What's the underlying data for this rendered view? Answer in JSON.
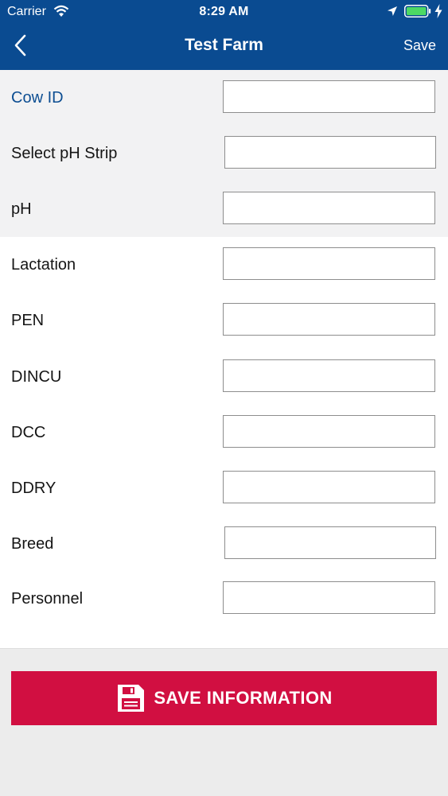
{
  "status_bar": {
    "carrier": "Carrier",
    "time": "8:29 AM"
  },
  "nav": {
    "title": "Test Farm",
    "save_label": "Save"
  },
  "form": {
    "fields": [
      {
        "label": "Cow ID",
        "value": ""
      },
      {
        "label": "Select pH Strip",
        "value": ""
      },
      {
        "label": "pH",
        "value": ""
      },
      {
        "label": "Lactation",
        "value": ""
      },
      {
        "label": "PEN",
        "value": ""
      },
      {
        "label": "DINCU",
        "value": ""
      },
      {
        "label": "DCC",
        "value": ""
      },
      {
        "label": "DDRY",
        "value": ""
      },
      {
        "label": "Breed",
        "value": ""
      },
      {
        "label": "Personnel",
        "value": ""
      }
    ]
  },
  "footer": {
    "save_button_label": "SAVE INFORMATION"
  },
  "colors": {
    "nav_background": "#0a4b91",
    "accent_label": "#0d4e92",
    "save_button": "#d10f41"
  },
  "icons": {
    "back": "chevron-left-icon",
    "wifi": "wifi-icon",
    "location": "location-arrow-icon",
    "battery": "battery-icon",
    "charging": "charging-bolt-icon",
    "save": "floppy-disk-icon"
  }
}
